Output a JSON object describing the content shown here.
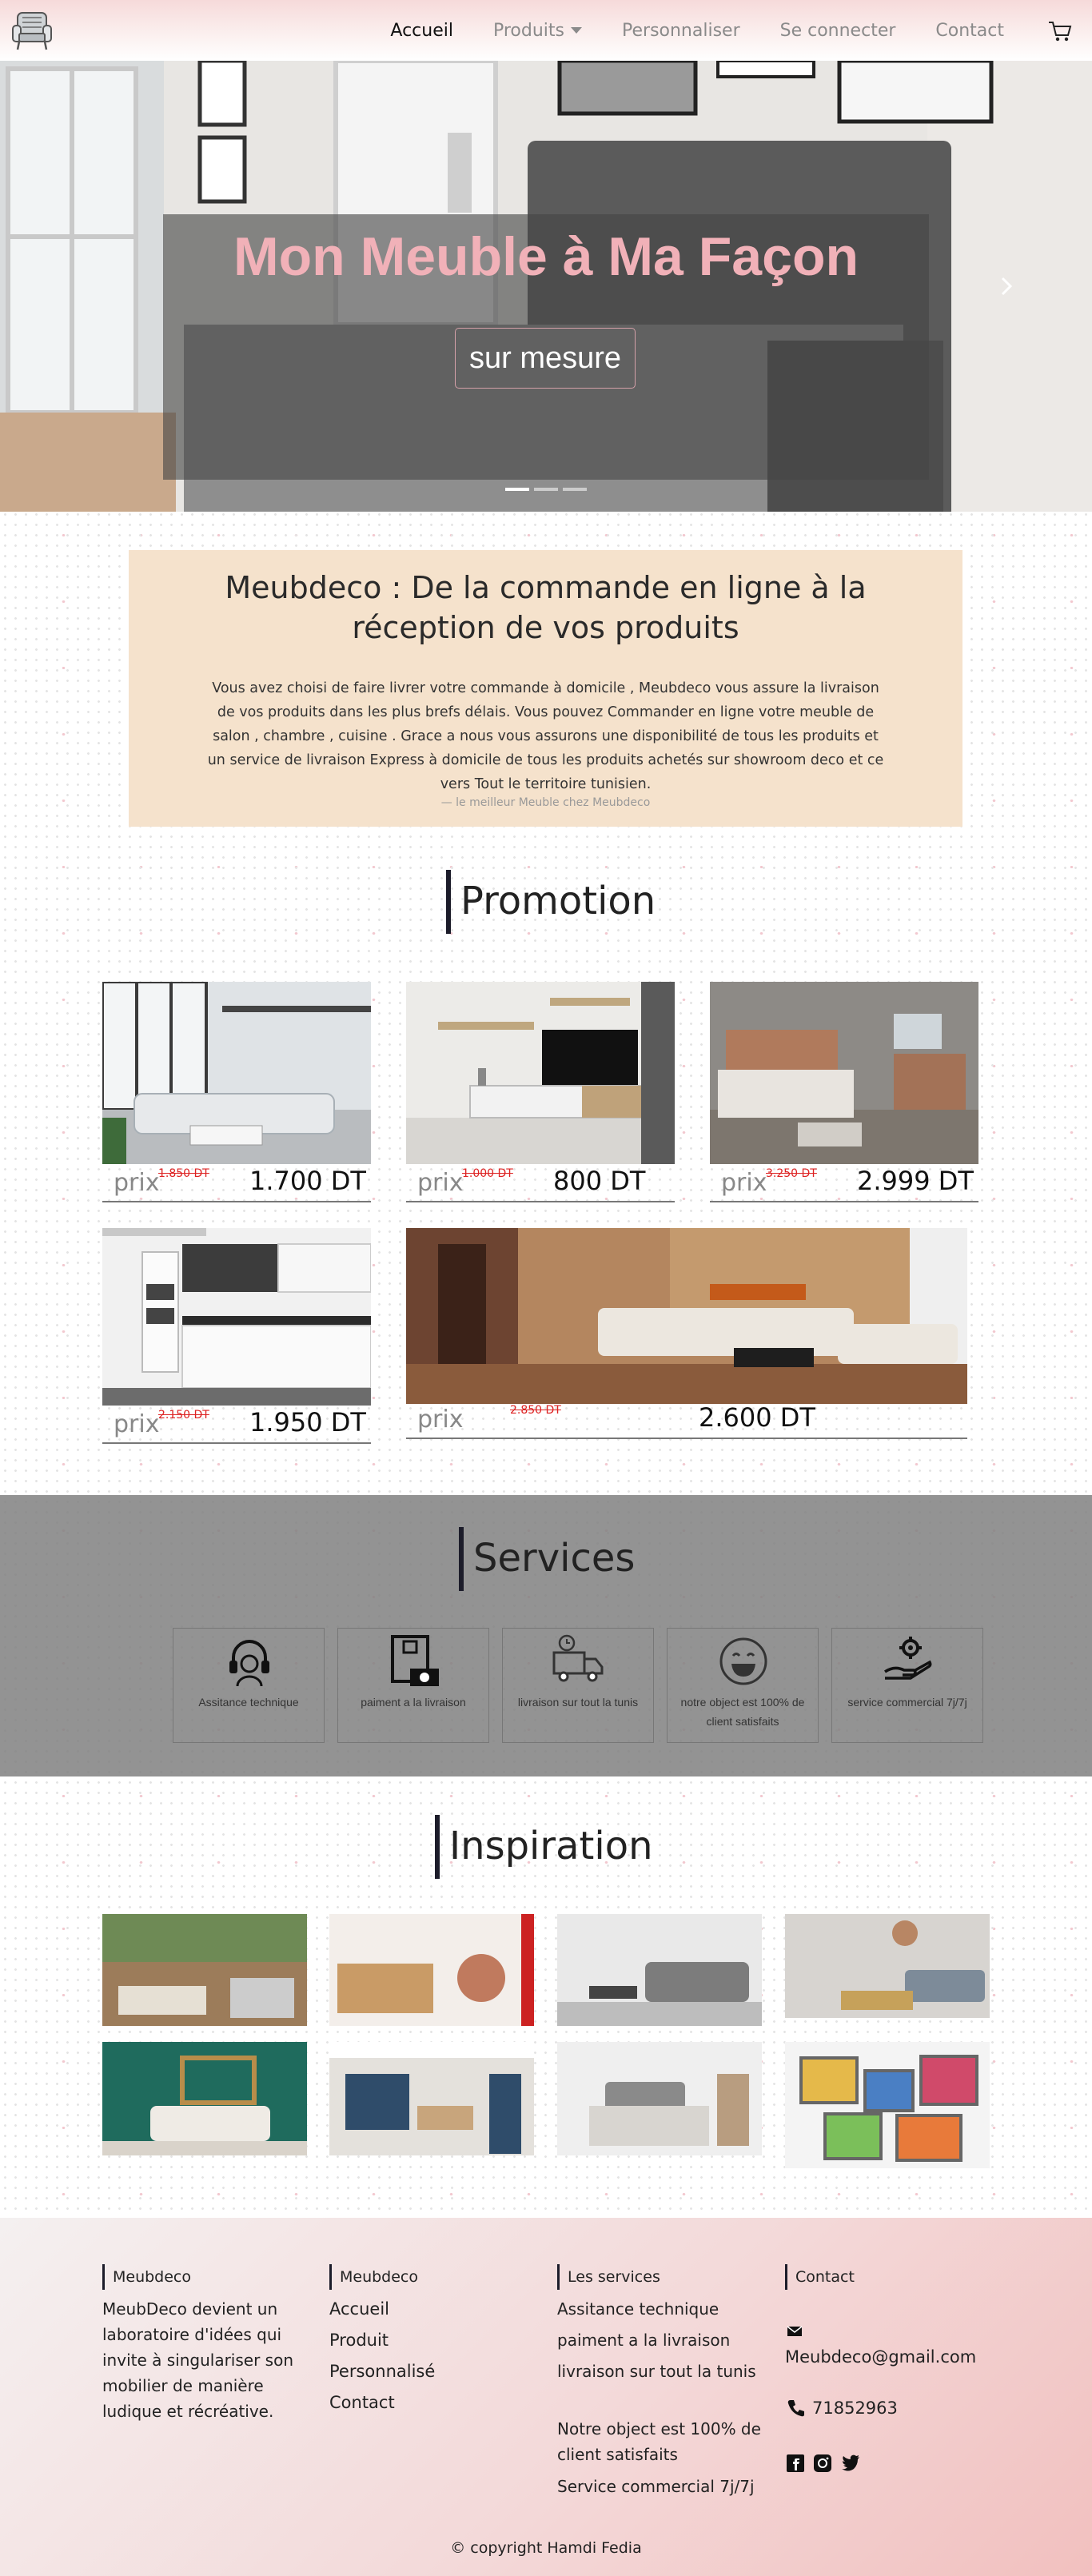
{
  "nav": {
    "links": [
      "Accueil",
      "Produits",
      "Personnaliser",
      "Se connecter",
      "Contact"
    ]
  },
  "hero": {
    "title": "Mon Meuble à Ma Façon",
    "button": "sur mesure"
  },
  "intro": {
    "title": "Meubdeco : De la commande en ligne à la réception de vos produits",
    "text": "Vous avez choisi de faire livrer votre commande à domicile , Meubdeco vous assure la livraison de vos produits dans les plus brefs délais. Vous pouvez Commander en ligne votre meuble de salon , chambre , cuisine . Grace a nous vous assurons une disponibilité de tous les produits et un service de livraison Express à domicile de tous les produits achetés sur showroom deco et ce vers Tout le territoire tunisien.",
    "cite": "— le meilleur Meuble chez Meubdeco"
  },
  "promotion": {
    "title": "Promotion",
    "prix_label": "prix",
    "products": [
      {
        "old": "1.850 DT",
        "new": "1.700 DT"
      },
      {
        "old": "1.000 DT",
        "new": "800 DT"
      },
      {
        "old": "3.250 DT",
        "new": "2.999 DT"
      },
      {
        "old": "2.150 DT",
        "new": "1.950 DT"
      },
      {
        "old": "2.850 DT",
        "new": "2.600 DT"
      }
    ]
  },
  "services": {
    "title": "Services",
    "items": [
      {
        "label": "Assitance technique",
        "icon": "headset-icon"
      },
      {
        "label": "paiment a la livraison",
        "icon": "cash-payment-icon"
      },
      {
        "label": "livraison sur tout la tunis",
        "icon": "delivery-truck-icon"
      },
      {
        "label": "notre object est 100% de client satisfaits",
        "icon": "smiley-icon"
      },
      {
        "label": "service commercial 7j/7j",
        "icon": "hand-gear-icon"
      }
    ]
  },
  "inspiration": {
    "title": "Inspiration"
  },
  "footer": {
    "col1": {
      "head": "Meubdeco",
      "text": "MeubDeco devient un laboratoire d'idées qui invite à singulariser son mobilier de manière ludique et récréative."
    },
    "col2": {
      "head": "Meubdeco",
      "links": [
        "Accueil",
        "Produit",
        "Personnalisé",
        "Contact"
      ]
    },
    "col3": {
      "head": "Les services",
      "items": [
        "Assitance technique",
        "paiment a la livraison",
        "livraison sur tout la tunis",
        "Notre object est 100% de client satisfaits",
        "Service commercial 7j/7j"
      ]
    },
    "col4": {
      "head": "Contact",
      "email": "Meubdeco@gmail.com",
      "phone": "71852963"
    },
    "copyright": "© copyright Hamdi Fedia"
  }
}
